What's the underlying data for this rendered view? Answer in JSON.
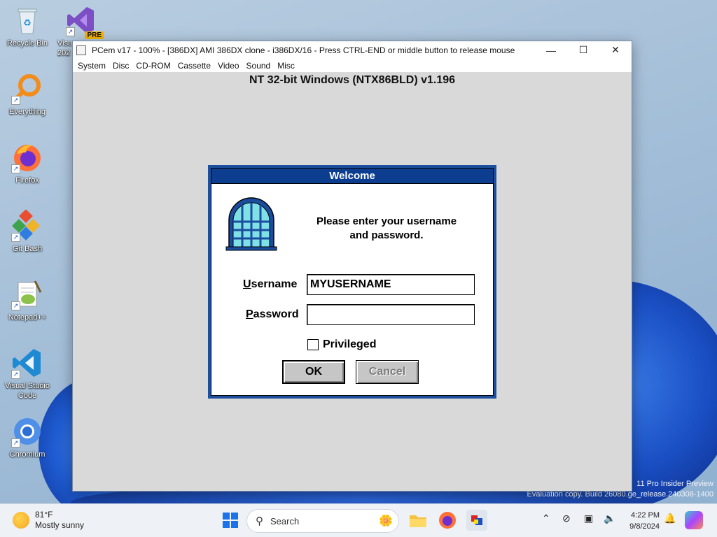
{
  "desktop": {
    "icons": [
      {
        "label": "Recycle Bin"
      },
      {
        "label": "Visu 202"
      },
      {
        "label": "Everything"
      },
      {
        "label": "Firefox"
      },
      {
        "label": "Git Bash"
      },
      {
        "label": "Notepad++"
      },
      {
        "label": "Visual Studio Code"
      },
      {
        "label": "Chromium"
      }
    ],
    "badge_pre": "PRE",
    "watermark_line1": "11 Pro Insider Preview",
    "watermark_line2": "Evaluation copy. Build 26080.ge_release.240308-1400"
  },
  "pcem": {
    "title": "PCem v17 - 100% - [386DX] AMI 386DX clone - i386DX/16 - Press CTRL-END or middle button to release mouse",
    "menu": [
      "System",
      "Disc",
      "CD-ROM",
      "Cassette",
      "Video",
      "Sound",
      "Misc"
    ],
    "controls": {
      "minimize": "—",
      "maximize": "☐",
      "close": "✕"
    }
  },
  "guest": {
    "banner": "NT 32-bit Windows (NTX86BLD) v1.196",
    "dialog": {
      "title": "Welcome",
      "prompt_line1": "Please enter your username",
      "prompt_line2": "and password.",
      "username_label_u": "U",
      "username_label_rest": "sername",
      "username_value": "MYUSERNAME",
      "password_label_u": "P",
      "password_label_rest": "assword",
      "password_value": "",
      "privileged_label": "Privileged",
      "privileged_checked": false,
      "ok_label": "OK",
      "cancel_label": "Cancel"
    }
  },
  "taskbar": {
    "weather_temp": "81°F",
    "weather_desc": "Mostly sunny",
    "search_label": "Search",
    "time": "4:22 PM",
    "date": "9/8/2024"
  },
  "colors": {
    "dialog_title_bg": "#0d3d8f",
    "dialog_border": "#1d4f9c",
    "guest_bg": "#d9d9d9"
  }
}
